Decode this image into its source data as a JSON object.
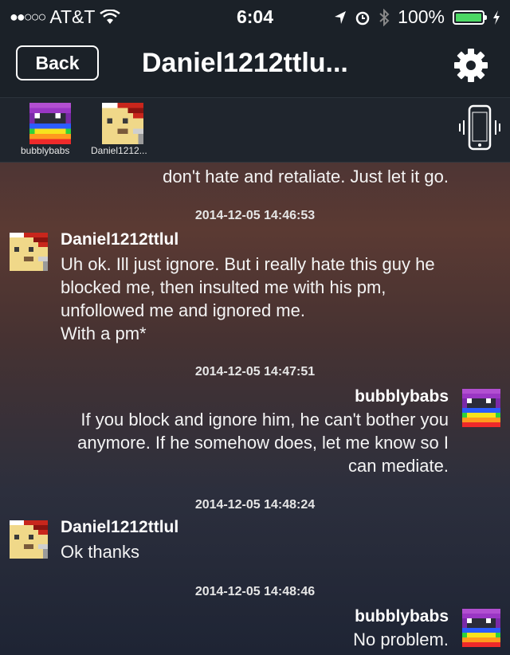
{
  "status_bar": {
    "carrier": "AT&T",
    "time": "6:04",
    "battery": "100%",
    "icons": [
      "signal-dots-icon",
      "wifi-icon",
      "location-arrow-icon",
      "alarm-icon",
      "bluetooth-icon",
      "battery-icon",
      "charging-icon"
    ]
  },
  "nav": {
    "back_label": "Back",
    "title": "Daniel1212ttlu...",
    "settings_icon": "gear-icon"
  },
  "participants": [
    {
      "label": "bubblybabs"
    },
    {
      "label": "Daniel1212..."
    }
  ],
  "vibrate_icon": "phone-vibrate-icon",
  "chat": {
    "partial_text": "don't hate and retaliate.  Just let it go.",
    "messages": [
      {
        "timestamp": "2014-12-05 14:46:53",
        "sender": "Daniel1212ttlul",
        "side": "left",
        "lines": [
          "Uh ok. Ill just ignore. But i really hate this guy he",
          "blocked me, then insulted me with his pm,",
          "unfollowed me and ignored me."
        ],
        "extra": "With a pm*"
      },
      {
        "timestamp": "2014-12-05 14:47:51",
        "sender": "bubblybabs",
        "side": "right",
        "lines": [
          "If you block and ignore him, he can't bother you",
          "anymore.  If he somehow does, let me know so I",
          "can mediate."
        ]
      },
      {
        "timestamp": "2014-12-05 14:48:24",
        "sender": "Daniel1212ttlul",
        "side": "left",
        "lines": [
          "Ok thanks"
        ]
      },
      {
        "timestamp": "2014-12-05 14:48:46",
        "sender": "bubblybabs",
        "side": "right",
        "lines": [
          "No problem."
        ]
      }
    ]
  },
  "colors": {
    "bar": "#1b2128",
    "battery_green": "#4cd964"
  }
}
